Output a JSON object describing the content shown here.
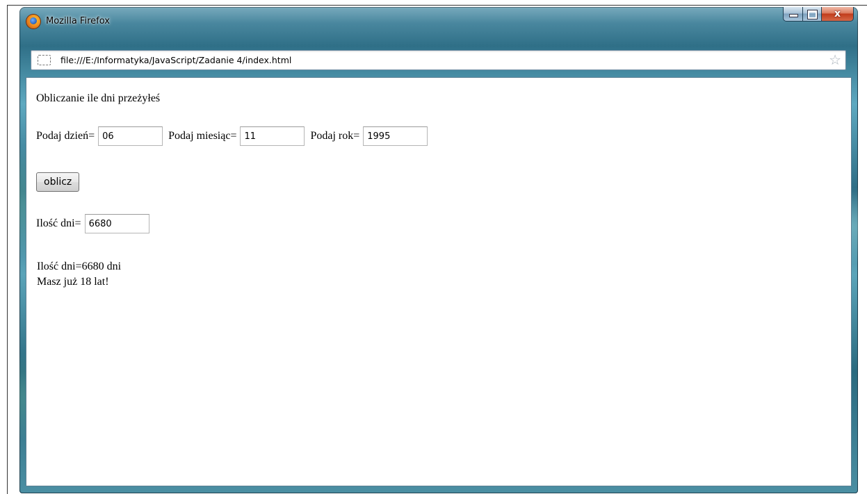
{
  "window": {
    "title": "Mozilla Firefox",
    "close_symbol": "x"
  },
  "address_bar": {
    "url": "file:///E:/Informatyka/JavaScript/Zadanie 4/index.html"
  },
  "page": {
    "heading": "Obliczanie ile dni przeżyłeś",
    "day_label": "Podaj dzień=",
    "day_value": "06",
    "month_label": "Podaj miesiąc=",
    "month_value": "11",
    "year_label": "Podaj rok=",
    "year_value": "1995",
    "button_label": "oblicz",
    "days_label": "Ilość dni=",
    "days_value": "6680",
    "output_line1": "Ilość dni=6680 dni",
    "output_line2": "Masz już 18 lat!"
  },
  "colors": {
    "window_glass": "#2f6f87",
    "close_button": "#c13c1b"
  },
  "icons": [
    "firefox-icon",
    "page-icon",
    "bookmark-star-icon",
    "minimize-icon",
    "maximize-icon",
    "close-icon"
  ]
}
